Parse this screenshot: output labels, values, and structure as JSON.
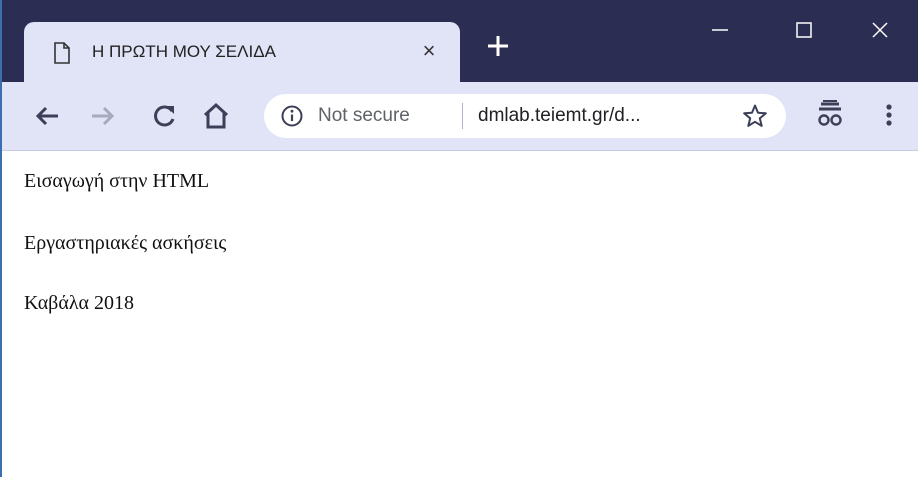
{
  "tab": {
    "title": "Η ΠΡΩΤΗ ΜΟΥ ΣΕΛΙΔΑ",
    "close_glyph": "×"
  },
  "toolbar": {
    "security_label": "Not secure",
    "url": "dmlab.teiemt.gr/d..."
  },
  "icons": {
    "page": "page-icon",
    "close": "close-icon",
    "new_tab": "plus-icon",
    "minimize": "minimize-icon",
    "maximize": "maximize-icon",
    "window_close": "close-icon",
    "back": "arrow-left-icon",
    "forward": "arrow-right-icon",
    "reload": "reload-icon",
    "home": "home-icon",
    "info": "info-icon",
    "star": "star-icon",
    "incognito": "incognito-icon",
    "menu": "kebab-menu-icon"
  },
  "colors": {
    "titlebar": "#2c2d52",
    "toolbar": "#e1e3f7",
    "window_border": "#3a6fb0"
  },
  "page": {
    "lines": [
      "Εισαγωγή στην HTML",
      "Εργαστηριακές ασκήσεις",
      "Καβάλα 2018"
    ]
  }
}
